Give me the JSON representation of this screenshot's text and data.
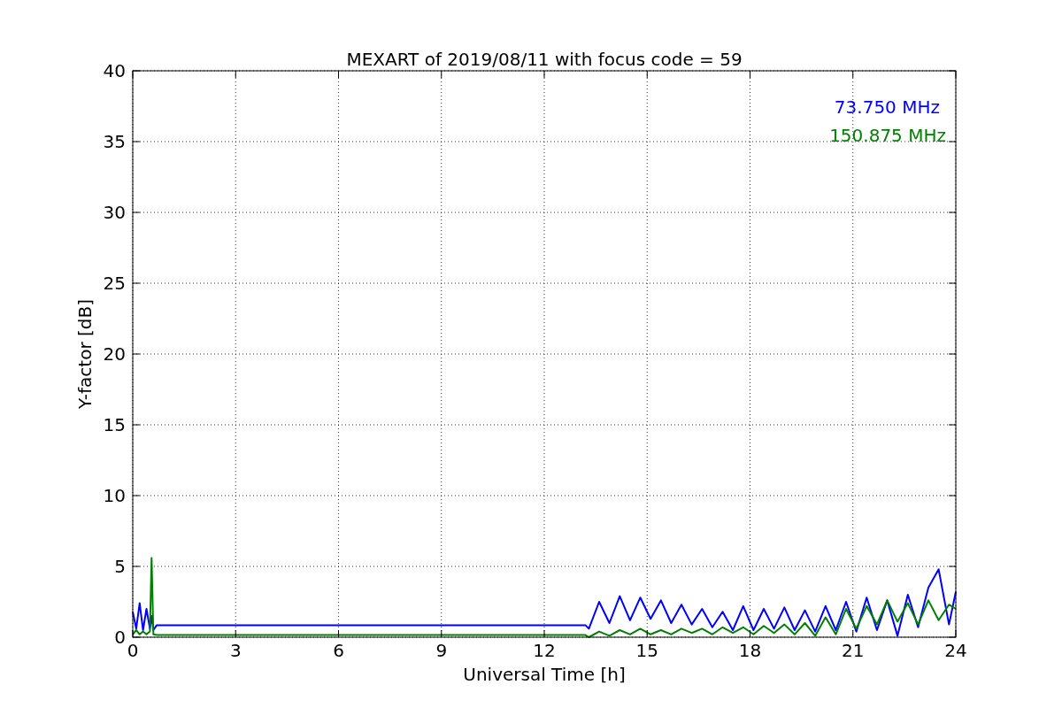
{
  "chart_data": {
    "type": "line",
    "title": "MEXART of 2019/08/11 with focus code = 59",
    "xlabel": "Universal Time [h]",
    "ylabel": "Y-factor [dB]",
    "xlim": [
      0,
      24
    ],
    "ylim": [
      0,
      40
    ],
    "xticks": [
      0,
      3,
      6,
      9,
      12,
      15,
      18,
      21,
      24
    ],
    "yticks": [
      0,
      5,
      10,
      15,
      20,
      25,
      30,
      35,
      40
    ],
    "grid": true,
    "x": [
      0,
      0.1,
      0.2,
      0.3,
      0.4,
      0.5,
      0.55,
      0.6,
      0.7,
      13.2,
      13.3,
      13.6,
      13.9,
      14.2,
      14.5,
      14.8,
      15.1,
      15.4,
      15.7,
      16.0,
      16.3,
      16.6,
      16.9,
      17.2,
      17.5,
      17.8,
      18.1,
      18.4,
      18.7,
      19.0,
      19.3,
      19.6,
      19.9,
      20.2,
      20.5,
      20.8,
      21.1,
      21.4,
      21.7,
      22.0,
      22.3,
      22.6,
      22.9,
      23.2,
      23.5,
      23.8,
      24.0
    ],
    "series": [
      {
        "name": "73.750 MHz",
        "color": "#0000ff",
        "values": [
          1.8,
          0.6,
          2.4,
          0.5,
          2.0,
          0.6,
          1.5,
          0.5,
          0.85,
          0.85,
          0.6,
          2.5,
          1.0,
          2.9,
          1.2,
          2.8,
          1.3,
          2.6,
          1.0,
          2.3,
          0.9,
          2.0,
          0.7,
          1.8,
          0.5,
          2.2,
          0.5,
          2.0,
          0.6,
          2.1,
          0.5,
          1.9,
          0.4,
          2.2,
          0.5,
          2.5,
          0.4,
          2.8,
          0.5,
          2.6,
          0.1,
          3.0,
          0.7,
          3.5,
          4.8,
          0.9,
          3.2
        ]
      },
      {
        "name": "150.875 MHz",
        "color": "#008000",
        "values": [
          0.2,
          0.5,
          0.2,
          0.4,
          0.2,
          0.4,
          5.6,
          0.2,
          0.15,
          0.15,
          0.0,
          0.4,
          0.1,
          0.5,
          0.2,
          0.6,
          0.2,
          0.5,
          0.2,
          0.6,
          0.3,
          0.6,
          0.2,
          0.7,
          0.3,
          0.7,
          0.2,
          0.8,
          0.3,
          0.9,
          0.2,
          1.0,
          0.1,
          1.4,
          0.2,
          2.0,
          0.6,
          2.2,
          0.9,
          2.6,
          1.1,
          2.4,
          0.9,
          2.6,
          1.2,
          2.3,
          2.0
        ]
      }
    ]
  }
}
